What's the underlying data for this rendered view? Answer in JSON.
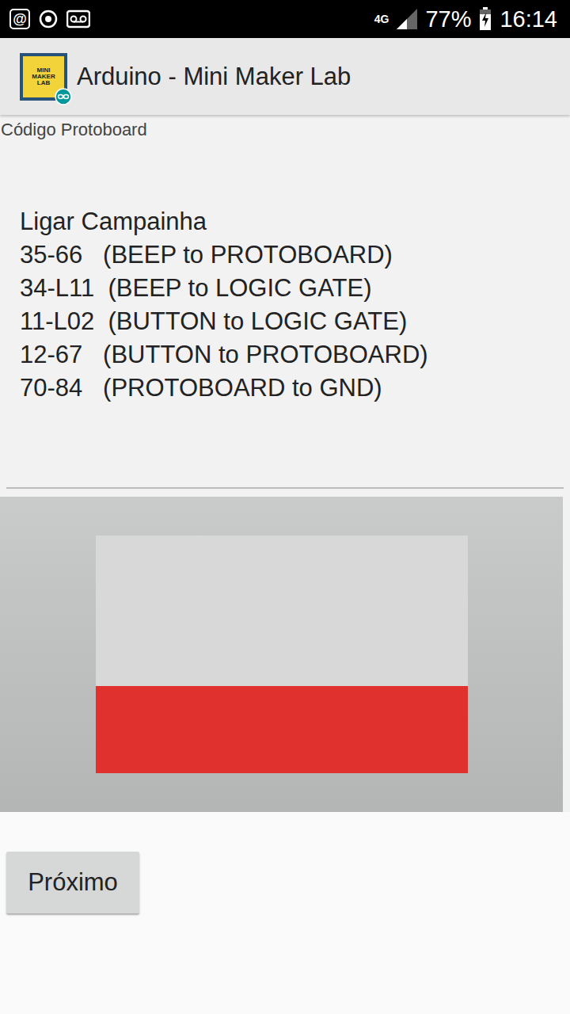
{
  "status_bar": {
    "notification_badge": "@",
    "network": "4G",
    "signal": {
      "level": 0.5
    },
    "battery": {
      "level": 0.77,
      "reading": "77%",
      "charging": true
    },
    "time": "16:14"
  },
  "app_bar": {
    "logo_text": [
      "MINI",
      "MAKER",
      "LAB"
    ],
    "title": "Arduino - Mini Maker Lab"
  },
  "field": {
    "label": "Código Protoboard",
    "title": "Ligar Campainha",
    "lines": [
      "35-66   (BEEP to PROTOBOARD)",
      "34-L11  (BEEP to LOGIC GATE)",
      "11-L02  (BUTTON to LOGIC GATE)",
      "12-67   (BUTTON to PROTOBOARD)",
      "70-84   (PROTOBOARD to GND)"
    ]
  },
  "buttons": [
    "Próximo"
  ]
}
